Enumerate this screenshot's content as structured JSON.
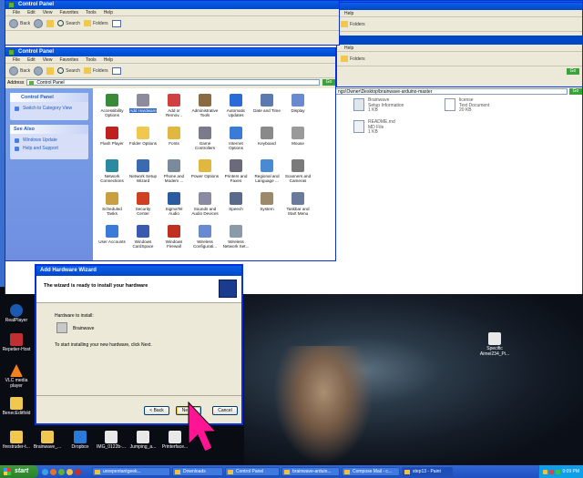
{
  "back_window": {
    "title": "",
    "menu": [
      "File",
      "Edit",
      "View",
      "Favorites",
      "Tools",
      "Help"
    ],
    "toolbar": {
      "back": "Back",
      "search": "Search",
      "folders": "Folders"
    },
    "help": "Help",
    "go": "Go",
    "address": "ngs\\Owner\\Desktop\\brainwave-arduino-master",
    "files": [
      {
        "name": "Brainwave",
        "line2": "Setup Information",
        "line3": "1 KB"
      },
      {
        "name": "license",
        "line2": "Text Document",
        "line3": "20 KB"
      },
      {
        "name": "README.md",
        "line2": "MD File",
        "line3": "1 KB"
      }
    ]
  },
  "mid_window": {
    "title": "Control Panel",
    "menu": [
      "File",
      "Edit",
      "View",
      "Favorites",
      "Tools",
      "Help"
    ],
    "toolbar": {
      "back": "Back",
      "search": "Search",
      "folders": "Folders"
    }
  },
  "front_window": {
    "title": "Control Panel",
    "menu": [
      "File",
      "Edit",
      "View",
      "Favorites",
      "Tools",
      "Help"
    ],
    "toolbar": {
      "back": "Back",
      "search": "Search",
      "folders": "Folders"
    },
    "address_label": "Address",
    "address": "Control Panel",
    "go": "Go",
    "left_panel": {
      "title": "Control Panel",
      "switch": "Switch to Category View",
      "see_also": "See Also",
      "links": [
        "Windows Update",
        "Help and Support"
      ]
    },
    "items": [
      [
        "Accessibility",
        "Options"
      ],
      [
        "Add Hardware",
        ""
      ],
      [
        "Add or",
        "Remov..."
      ],
      [
        "Administrative",
        "Tools"
      ],
      [
        "Automatic",
        "Updates"
      ],
      [
        "Date and Time",
        ""
      ],
      [
        "Display",
        ""
      ],
      [
        "Flash Player",
        ""
      ],
      [
        "Folder Options",
        ""
      ],
      [
        "Fonts",
        ""
      ],
      [
        "Game",
        "Controllers"
      ],
      [
        "Internet",
        "Options"
      ],
      [
        "Keyboard",
        ""
      ],
      [
        "Mouse",
        ""
      ],
      [
        "Network",
        "Connections"
      ],
      [
        "Network Setup",
        "Wizard"
      ],
      [
        "Phone and",
        "Modem ..."
      ],
      [
        "Power Options",
        ""
      ],
      [
        "Printers and",
        "Faxes"
      ],
      [
        "Regional and",
        "Language ..."
      ],
      [
        "Scanners and",
        "Cameras"
      ],
      [
        "Scheduled",
        "Tasks"
      ],
      [
        "Security",
        "Center"
      ],
      [
        "SigmaTel",
        "Audio"
      ],
      [
        "Sounds and",
        "Audio Devices"
      ],
      [
        "Speech",
        ""
      ],
      [
        "System",
        ""
      ],
      [
        "Taskbar and",
        "Start Menu"
      ],
      [
        "User Accounts",
        ""
      ],
      [
        "Windows",
        "CardSpace"
      ],
      [
        "Windows",
        "Firewall"
      ],
      [
        "Wireless",
        "Configurati..."
      ],
      [
        "Wireless",
        "Network Set..."
      ]
    ]
  },
  "wizard": {
    "title": "Add Hardware Wizard",
    "heading": "The wizard is ready to install your hardware",
    "hw_label": "Hardware to install:",
    "hw_name": "Brainwave",
    "instruction": "To start installing your new hardware, click Next.",
    "back": "< Back",
    "next": "Next >",
    "cancel": "Cancel"
  },
  "desktop_icons": [
    "RealPlayer",
    "Repetier-Host",
    "VLC media player",
    "BenecEditfold",
    "firestruder-t...",
    "Brainwave_...",
    "Dropbox",
    "IMG_0122b-...",
    "Jumping_a...",
    "Printerface...",
    "Specific Aimei234_Pi..."
  ],
  "taskbar": {
    "start": "start",
    "items": [
      "unrepentantgeek...",
      "Downloads",
      "Control Panel",
      "brainwave-arduin...",
      "Compose Mail - c...",
      "step13 - Paint"
    ],
    "clock": "9:09 PM"
  },
  "colors": {
    "xp_blue": "#0047c8",
    "taskbar": "#245edb",
    "start_green": "#3c9a3c",
    "panel_blue": "#6f8ee0",
    "cursor": "#ff1493"
  }
}
